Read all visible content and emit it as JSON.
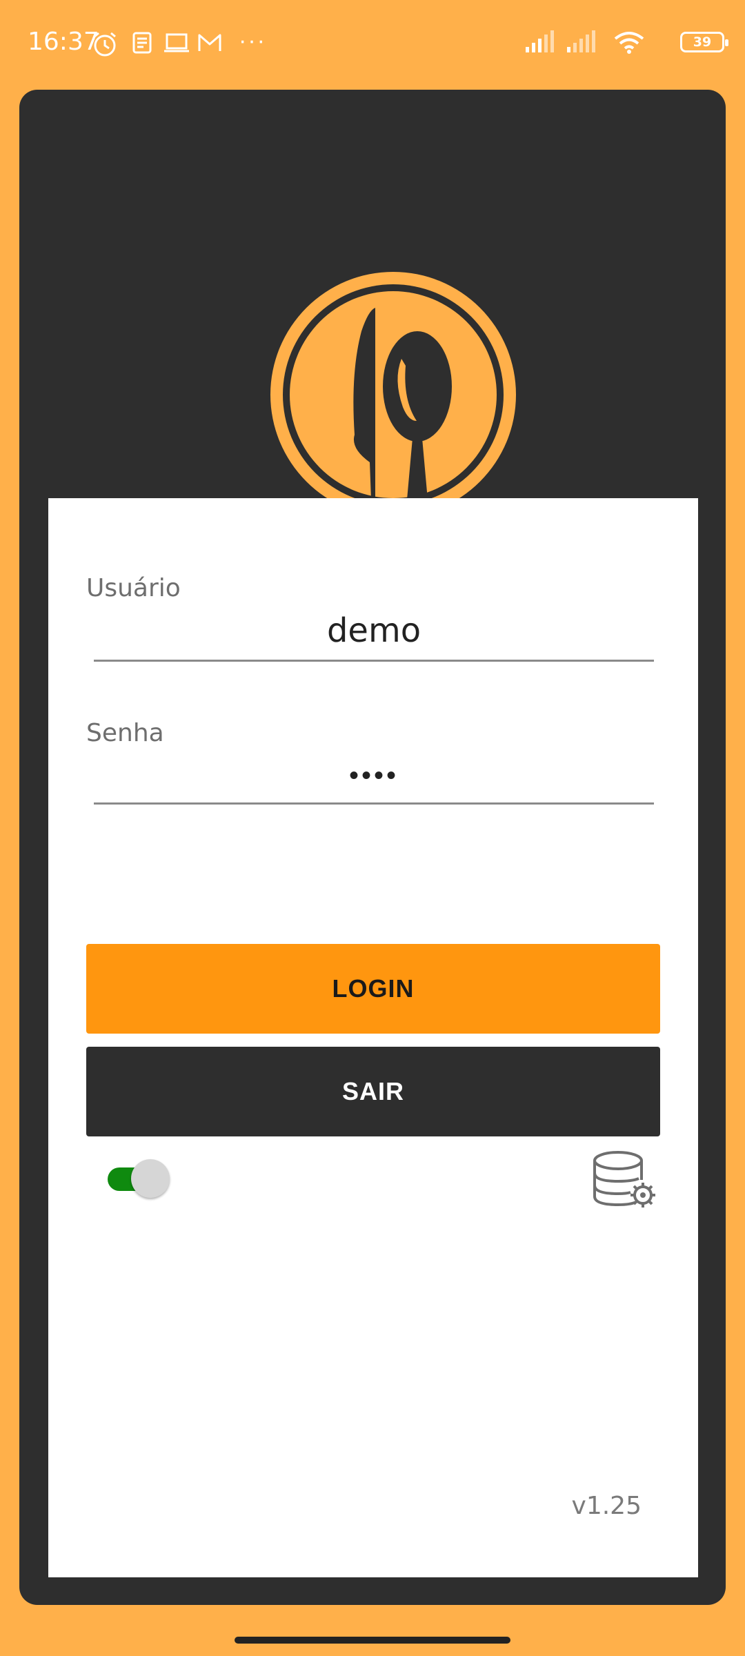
{
  "status_bar": {
    "time": "16:37",
    "more_indicator": "···",
    "battery_level": "39",
    "icons_left": [
      "alarm-icon",
      "news-icon",
      "laptop-icon",
      "gmail-icon"
    ],
    "icons_right": [
      "signal-icon",
      "signal-icon",
      "wifi-icon",
      "battery-icon"
    ]
  },
  "brand": {
    "logo": "knife-spoon-logo",
    "accent_color": "#FFB04A",
    "dark_color": "#2E2E2E",
    "loading_dot_color": "#4AB3E6"
  },
  "form": {
    "user_label": "Usuário",
    "user_value": "demo",
    "password_label": "Senha",
    "password_masked": "••••",
    "login_button": "LOGIN",
    "exit_button": "SAIR",
    "toggle_on": true,
    "db_settings_icon": "database-settings-icon",
    "version": "v1.25"
  }
}
